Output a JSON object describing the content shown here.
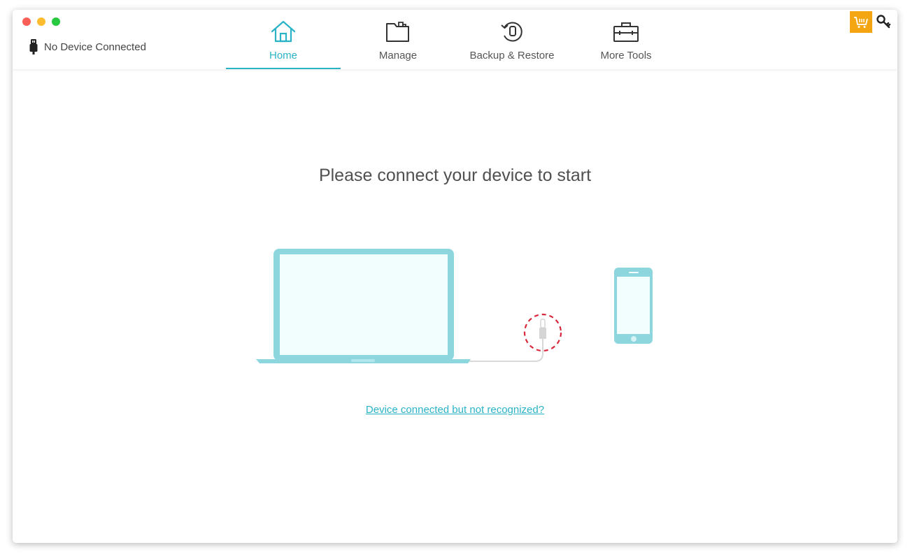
{
  "window": {
    "controls": [
      "close",
      "minimize",
      "maximize"
    ]
  },
  "device_status": {
    "icon": "usb-plug-icon",
    "text": "No Device Connected"
  },
  "tabs": [
    {
      "label": "Home",
      "icon": "home-icon",
      "active": true
    },
    {
      "label": "Manage",
      "icon": "folder-icon",
      "active": false
    },
    {
      "label": "Backup & Restore",
      "icon": "backup-restore-icon",
      "active": false
    },
    {
      "label": "More Tools",
      "icon": "toolbox-icon",
      "active": false
    }
  ],
  "top_right": {
    "cart_icon": "shopping-cart-icon",
    "key_icon": "key-icon"
  },
  "main": {
    "title": "Please connect your device to start",
    "illustration": [
      "laptop",
      "lightning-cable",
      "phone"
    ],
    "help_link": "Device connected but not recognized?"
  },
  "colors": {
    "accent": "#2ab3c6",
    "device_fill": "#8ed6de",
    "screen_fill": "#f2fdfe",
    "cart_bg": "#f3a512",
    "warning_dash": "#d9283b"
  }
}
